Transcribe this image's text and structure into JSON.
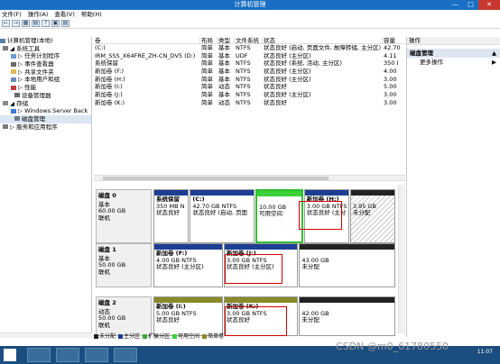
{
  "window": {
    "title": "计算机管理",
    "minimize": "—",
    "maximize": "□",
    "close": "✕"
  },
  "menu": [
    "文件(F)",
    "操作(A)",
    "查看(V)",
    "帮助(H)"
  ],
  "toolbar": [
    "←",
    "→",
    "▦",
    "▤",
    "?",
    "▣",
    "▤"
  ],
  "tree": [
    {
      "label": "计算机管理(本地)",
      "icon": "computer-icon",
      "color": "#5a7fa8"
    },
    {
      "label": "◢ 系统工具",
      "icon": "tools-icon",
      "color": "#7a7a7a"
    },
    {
      "label": "▷ 任务计划程序",
      "icon": "clock-icon",
      "color": "#6a9bd0"
    },
    {
      "label": "▷ 事件查看器",
      "icon": "event-icon",
      "color": "#6a6a6a"
    },
    {
      "label": "▷ 共享文件夹",
      "icon": "folder-icon",
      "color": "#e3b85a"
    },
    {
      "label": "▷ 本地用户和组",
      "icon": "users-icon",
      "color": "#6a8fbf"
    },
    {
      "label": "▷ 性能",
      "icon": "perf-icon",
      "color": "#c04040"
    },
    {
      "label": "设备管理器",
      "icon": "device-icon",
      "color": "#6a6a6a"
    },
    {
      "label": "◢ 存储",
      "icon": "storage-icon",
      "color": "#8a8a8a"
    },
    {
      "label": "▷ Windows Server Back",
      "icon": "backup-icon",
      "color": "#3a7bd5"
    },
    {
      "label": "磁盘管理",
      "icon": "disk-icon",
      "color": "#6a7a8a"
    },
    {
      "label": "▷ 服务和应用程序",
      "icon": "services-icon",
      "color": "#7a7a7a"
    }
  ],
  "volume_header": [
    "卷",
    "布局",
    "类型",
    "文件系统",
    "状态",
    "容量"
  ],
  "volumes": [
    [
      "(C:)",
      "简单",
      "基本",
      "NTFS",
      "状态良好 (启动, 页面文件, 故障转储, 主分区)",
      "42.70"
    ],
    [
      "IRM_SSS_X64FRE_ZH-CN_DV5 (D:)",
      "简单",
      "基本",
      "UDF",
      "状态良好 (主分区)",
      "4.11"
    ],
    [
      "系统保留",
      "简单",
      "基本",
      "NTFS",
      "状态良好 (系统, 活动, 主分区)",
      "350 I"
    ],
    [
      "新加卷 (F:)",
      "简单",
      "基本",
      "NTFS",
      "状态良好 (主分区)",
      "4.00"
    ],
    [
      "新加卷 (H:)",
      "简单",
      "基本",
      "NTFS",
      "状态良好 (主分区)",
      "3.00"
    ],
    [
      "新加卷 (I:)",
      "简单",
      "动态",
      "NTFS",
      "状态良好",
      "5.00"
    ],
    [
      "新加卷 (J:)",
      "简单",
      "基本",
      "NTFS",
      "状态良好 (主分区)",
      "3.00"
    ],
    [
      "新加卷 (K:)",
      "简单",
      "动态",
      "NTFS",
      "状态良好",
      "3.00"
    ]
  ],
  "disks": [
    {
      "label": [
        "磁盘 0",
        "基本",
        "60.00 GB",
        "联机"
      ],
      "parts": [
        {
          "lines": [
            "系统保留",
            "350 MB N",
            "状态良好"
          ],
          "cap": "#1c3f94",
          "w": 0.15
        },
        {
          "lines": [
            "(C:)",
            "42.70 GB NTFS",
            "状态良好 (启动, 页面"
          ],
          "cap": "#1c3f94",
          "w": 0.27
        },
        {
          "lines": [
            "",
            "10.00 GB",
            "可用空间"
          ],
          "cap": "#3ad13a",
          "w": 0.2,
          "free": true
        },
        {
          "lines": [
            "新加卷  (H:)",
            "3.00 GB NTFS",
            "状态良好 (主分"
          ],
          "cap": "#1c3f94",
          "w": 0.19
        },
        {
          "lines": [
            "",
            "3.95 GB",
            "未分配"
          ],
          "cap": "#222222",
          "w": 0.19,
          "unalloc": true
        }
      ]
    },
    {
      "label": [
        "磁盘 1",
        "基本",
        "50.00 GB",
        "联机"
      ],
      "parts": [
        {
          "lines": [
            "新加卷  (F:)",
            "4.00 GB NTFS",
            "状态良好 (主分区)"
          ],
          "cap": "#1c3f94",
          "w": 0.29
        },
        {
          "lines": [
            "新加卷  (J:)",
            "3.00 GB NTFS",
            "状态良好 (主分区)"
          ],
          "cap": "#1c3f94",
          "w": 0.31
        },
        {
          "lines": [
            "",
            "43.00 GB",
            "未分配"
          ],
          "cap": "#222222",
          "w": 0.4
        }
      ]
    },
    {
      "label": [
        "磁盘 2",
        "动态",
        "50.00 GB",
        "联机"
      ],
      "parts": [
        {
          "lines": [
            "新加卷  (I:)",
            "5.00 GB NTFS",
            "状态良好"
          ],
          "cap": "#8a8a2a",
          "w": 0.29
        },
        {
          "lines": [
            "新加卷  (K:)",
            "3.00 GB NTFS",
            "状态良好"
          ],
          "cap": "#8a8a2a",
          "w": 0.31
        },
        {
          "lines": [
            "",
            "42.00 GB",
            "未分配"
          ],
          "cap": "#222222",
          "w": 0.4
        }
      ]
    }
  ],
  "legend": [
    {
      "label": "未分配",
      "color": "#222222"
    },
    {
      "label": "主分区",
      "color": "#1c3f94"
    },
    {
      "label": "扩展分区",
      "color": "#3aa53a"
    },
    {
      "label": "可用空间",
      "color": "#3ad13a"
    },
    {
      "label": "简单卷",
      "color": "#8a8a2a"
    }
  ],
  "actions": {
    "header": "操作",
    "section": "磁盘管理",
    "section_arrow": "▲",
    "item": "更多操作",
    "item_arrow": "▶"
  },
  "taskbar": {
    "time": "11:07"
  },
  "watermark": "CSDN @m0_61780550"
}
